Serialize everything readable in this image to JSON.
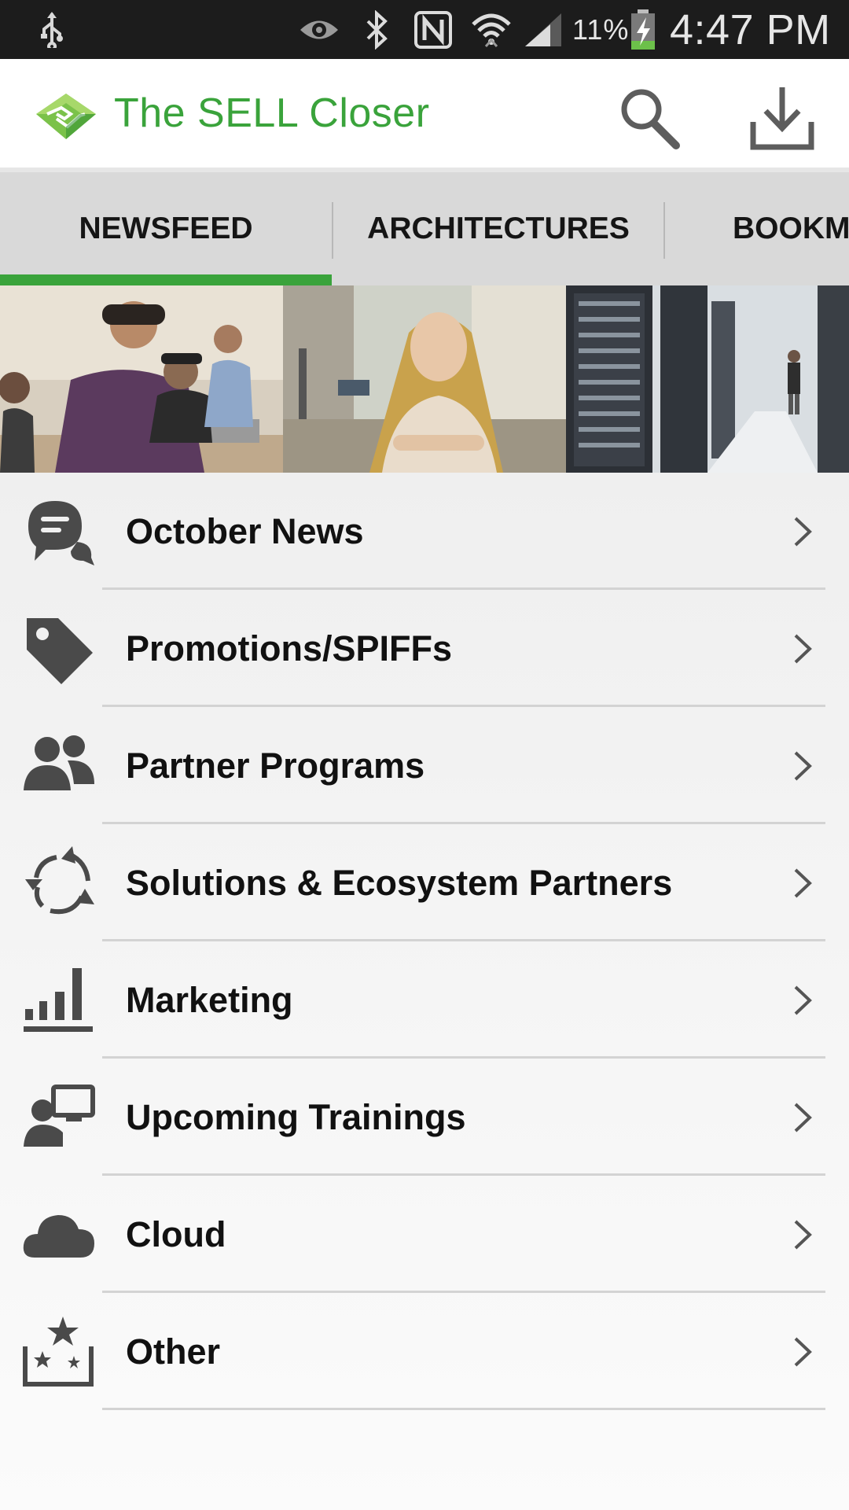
{
  "status_bar": {
    "battery_percent": "11%",
    "time": "4:47 PM",
    "icons": [
      "usb-icon",
      "eye-icon",
      "bluetooth-icon",
      "nfc-icon",
      "wifi-icon",
      "signal-icon",
      "battery-charging-icon"
    ]
  },
  "app_bar": {
    "title": "The SELL Closer",
    "logo": "handshake-logo",
    "actions": [
      "search-icon",
      "download-icon"
    ],
    "accent_color": "#3aa33b"
  },
  "tabs": [
    {
      "label": "NEWSFEED",
      "selected": true
    },
    {
      "label": "ARCHITECTURES",
      "selected": false
    },
    {
      "label": "BOOKM",
      "selected": false
    }
  ],
  "banner": {
    "panels": [
      "people-at-laptops-photo",
      "woman-portrait-photo",
      "server-room-photo"
    ]
  },
  "list": {
    "items": [
      {
        "label": "October News",
        "icon": "chat-bubbles-icon"
      },
      {
        "label": "Promotions/SPIFFs",
        "icon": "tag-icon"
      },
      {
        "label": "Partner Programs",
        "icon": "people-icon"
      },
      {
        "label": "Solutions & Ecosystem Partners",
        "icon": "cycle-arrows-icon"
      },
      {
        "label": "Marketing",
        "icon": "bar-chart-icon"
      },
      {
        "label": "Upcoming Trainings",
        "icon": "person-monitor-icon"
      },
      {
        "label": "Cloud",
        "icon": "cloud-icon"
      },
      {
        "label": "Other",
        "icon": "star-box-icon"
      }
    ]
  }
}
